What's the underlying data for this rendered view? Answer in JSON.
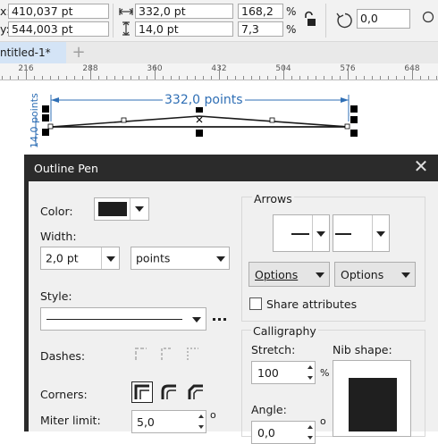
{
  "propbar": {
    "x_prefix": "x:",
    "y_prefix": "y:",
    "x_value": "410,037 pt",
    "y_value": "544,003 pt",
    "width_value": "332,0 pt",
    "height_value": "14,0 pt",
    "scale_w_value": "168,2",
    "scale_h_value": "7,3",
    "percent_symbol": "%",
    "rotation_value": "0,0"
  },
  "tabs": {
    "document_tab": "ntitled-1*",
    "add_tab": "+"
  },
  "ruler": {
    "labels": [
      "216",
      "288",
      "360",
      "432",
      "504",
      "576",
      "648"
    ]
  },
  "canvas": {
    "width_dimension": "332,0 points",
    "height_dimension": "14,0 points"
  },
  "dialog": {
    "title": "Outline Pen",
    "color_label": "Color:",
    "width_label": "Width:",
    "width_value": "2,0 pt",
    "units_value": "points",
    "style_label": "Style:",
    "dashes_label": "Dashes:",
    "corners_label": "Corners:",
    "miter_label": "Miter limit:",
    "miter_value": "5,0",
    "degree_symbol": "o",
    "arrows_title": "Arrows",
    "options_left": "Options",
    "options_right": "Options",
    "share_attributes": "Share attributes",
    "calligraphy_title": "Calligraphy",
    "stretch_label": "Stretch:",
    "stretch_value": "100",
    "nib_label": "Nib shape:",
    "angle_label": "Angle:",
    "angle_value": "0,0",
    "percent_symbol": "%"
  },
  "colors": {
    "dialog_title_bg": "#2b2b2b",
    "dialog_body_bg": "#f0f0f0",
    "dimension_blue": "#2f6fb5",
    "tab_active_bg": "#d4e4f6",
    "swatch": "#1f1f1f"
  }
}
